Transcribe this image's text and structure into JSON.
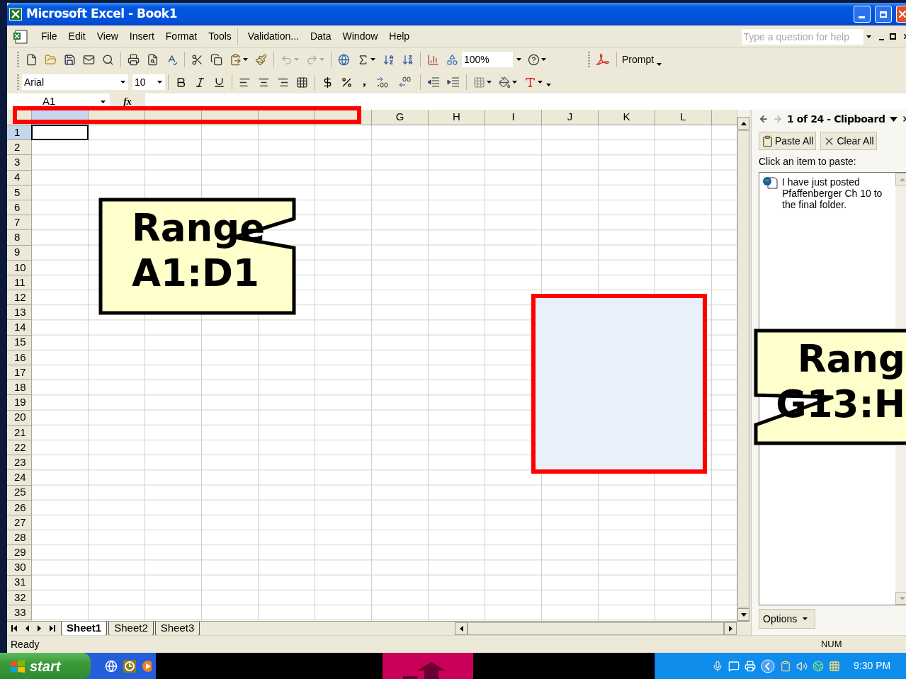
{
  "window": {
    "title": "Microsoft Excel - Book1"
  },
  "menu": [
    "File",
    "Edit",
    "View",
    "Insert",
    "Format",
    "Tools",
    "Validation...",
    "Data",
    "Window",
    "Help"
  ],
  "help_box": {
    "placeholder": "Type a question for help"
  },
  "standard_toolbar": {
    "zoom": "100%",
    "prompt_button": "Prompt"
  },
  "formatting_toolbar": {
    "font": "Arial",
    "size": "10"
  },
  "formula_bar": {
    "name_box": "A1",
    "function_label": "fx"
  },
  "sheet": {
    "columns": [
      {
        "selected": true
      },
      {
        "selected": false
      },
      {
        "selected": false
      },
      {
        "selected": false
      },
      {
        "selected": false
      },
      {
        "selected": false
      },
      {
        "label": "G",
        "selected": false
      },
      {
        "label": "H",
        "selected": false
      },
      {
        "label": "I",
        "selected": false
      },
      {
        "label": "J",
        "selected": false
      },
      {
        "label": "K",
        "selected": false
      },
      {
        "label": "L",
        "selected": false
      }
    ],
    "rows": [
      {
        "label": "1",
        "selected": true
      },
      {
        "label": "2",
        "selected": false
      },
      {
        "label": "3",
        "selected": false
      },
      {
        "label": "4",
        "selected": false
      },
      {
        "label": "5",
        "selected": false
      },
      {
        "label": "6",
        "selected": false
      },
      {
        "label": "7",
        "selected": false
      },
      {
        "label": "8",
        "selected": false
      },
      {
        "label": "9",
        "selected": false
      },
      {
        "label": "10",
        "selected": false
      },
      {
        "label": "11",
        "selected": false
      },
      {
        "label": "12",
        "selected": false
      },
      {
        "label": "13",
        "selected": false
      },
      {
        "label": "14",
        "selected": false
      },
      {
        "label": "15",
        "selected": false
      },
      {
        "label": "16",
        "selected": false
      },
      {
        "label": "17",
        "selected": false
      },
      {
        "label": "18",
        "selected": false
      },
      {
        "label": "19",
        "selected": false
      },
      {
        "label": "20",
        "selected": false
      },
      {
        "label": "21",
        "selected": false
      },
      {
        "label": "22",
        "selected": false
      },
      {
        "label": "23",
        "selected": false
      },
      {
        "label": "24",
        "selected": false
      },
      {
        "label": "25",
        "selected": false
      },
      {
        "label": "26",
        "selected": false
      },
      {
        "label": "27",
        "selected": false
      },
      {
        "label": "28",
        "selected": false
      },
      {
        "label": "29",
        "selected": false
      },
      {
        "label": "30",
        "selected": false
      },
      {
        "label": "31",
        "selected": false
      },
      {
        "label": "32",
        "selected": false
      },
      {
        "label": "33",
        "selected": false
      }
    ]
  },
  "sheet_tabs": [
    {
      "label": "Sheet1",
      "selected": true
    },
    {
      "label": "Sheet2",
      "selected": false
    },
    {
      "label": "Sheet3",
      "selected": false
    }
  ],
  "status_bar": {
    "left": "Ready",
    "num": "NUM"
  },
  "task_pane": {
    "title": "1 of 24 - Clipboard",
    "buttons": [
      "Paste All",
      "Clear All"
    ],
    "hint": "Click an item to paste:",
    "items": [
      "I have just posted Pfaffenberger Ch 10 to the final folder."
    ],
    "options": "Options"
  },
  "callouts": [
    {
      "lines": [
        "Range",
        "A1:D1"
      ]
    },
    {
      "lines": [
        "Rang",
        "G13:H"
      ]
    }
  ],
  "taskbar": {
    "start": "start",
    "clock": "9:30 PM"
  }
}
